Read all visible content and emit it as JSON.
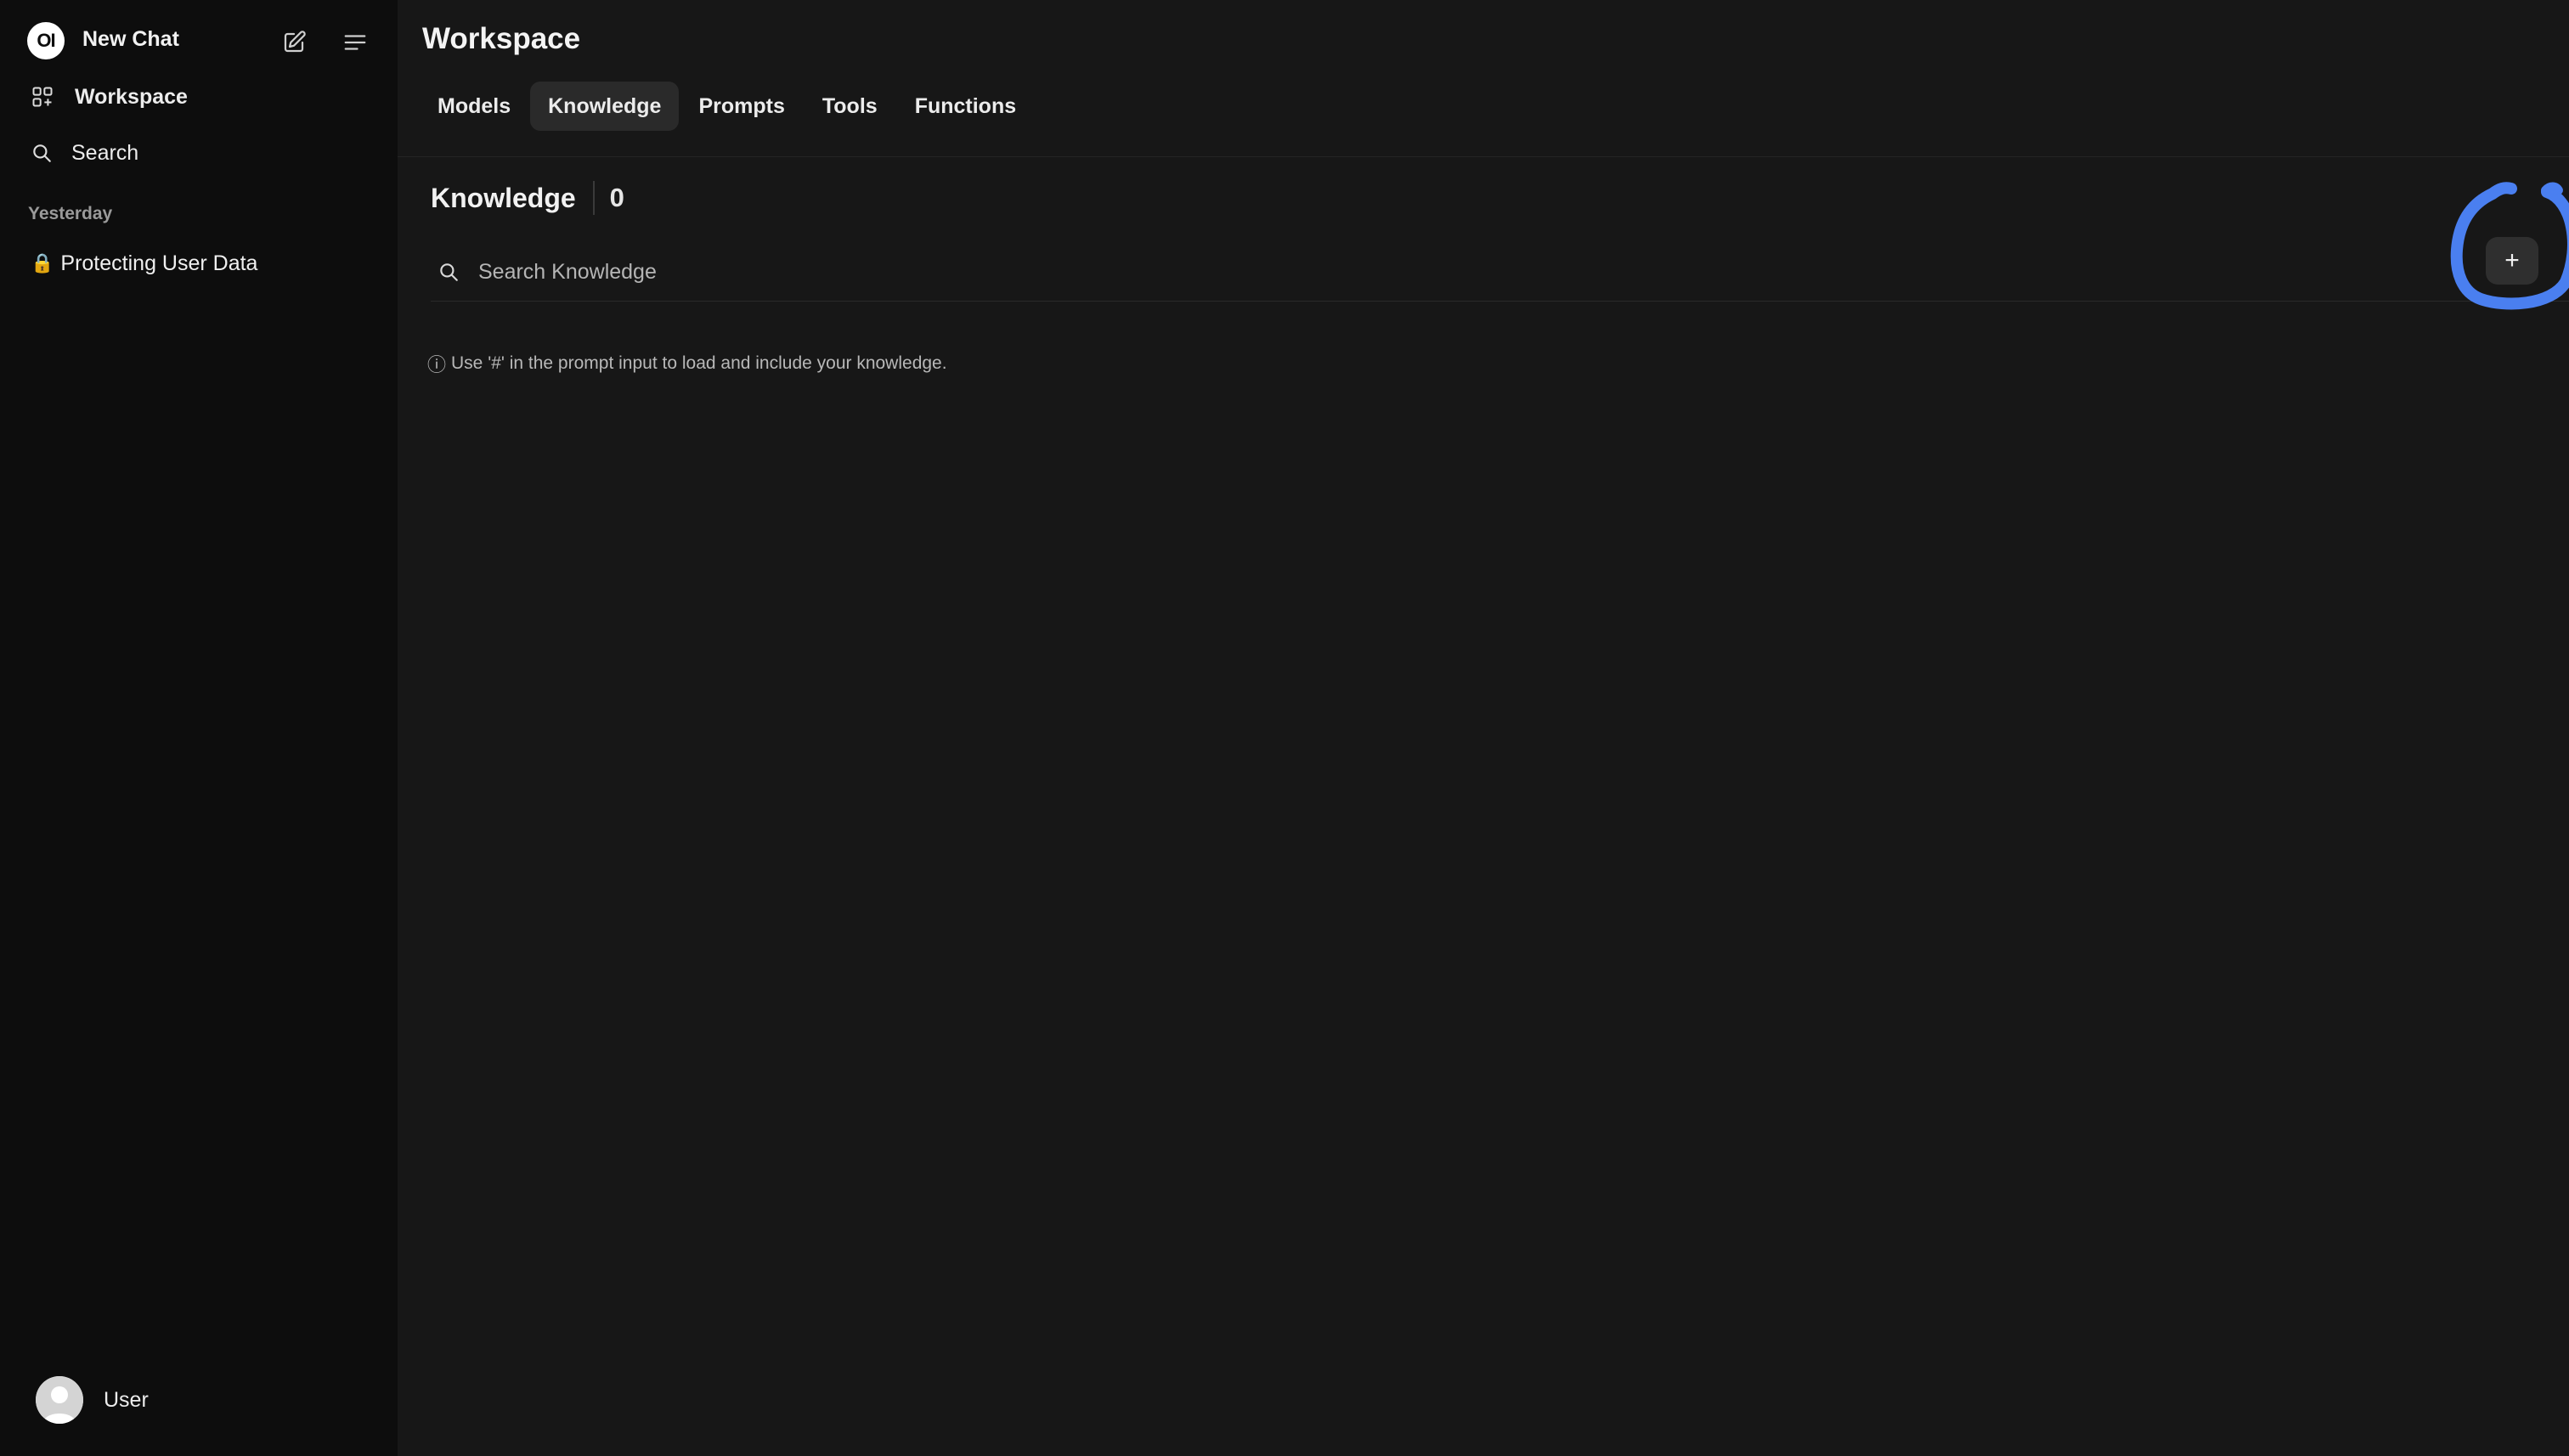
{
  "sidebar": {
    "logo_text": "OI",
    "new_chat_label": "New Chat",
    "nav": {
      "workspace_label": "Workspace",
      "search_label": "Search"
    },
    "sections": [
      {
        "label": "Yesterday",
        "chats": [
          {
            "icon": "🔒",
            "title": "Protecting User Data"
          }
        ]
      }
    ],
    "user": {
      "name": "User"
    }
  },
  "main": {
    "title": "Workspace",
    "tabs": [
      {
        "label": "Models",
        "active": false
      },
      {
        "label": "Knowledge",
        "active": true
      },
      {
        "label": "Prompts",
        "active": false
      },
      {
        "label": "Tools",
        "active": false
      },
      {
        "label": "Functions",
        "active": false
      }
    ],
    "knowledge": {
      "title": "Knowledge",
      "count": "0",
      "search_placeholder": "Search Knowledge",
      "search_value": "",
      "add_label": "+",
      "hint": "Use '#' in the prompt input to load and include your knowledge.",
      "hint_icon": "ⓘ"
    }
  },
  "colors": {
    "sidebar_bg": "#0d0d0d",
    "main_bg": "#171717",
    "active_tab_bg": "#2a2a2a",
    "annotation_blue": "#4a7ff0"
  }
}
